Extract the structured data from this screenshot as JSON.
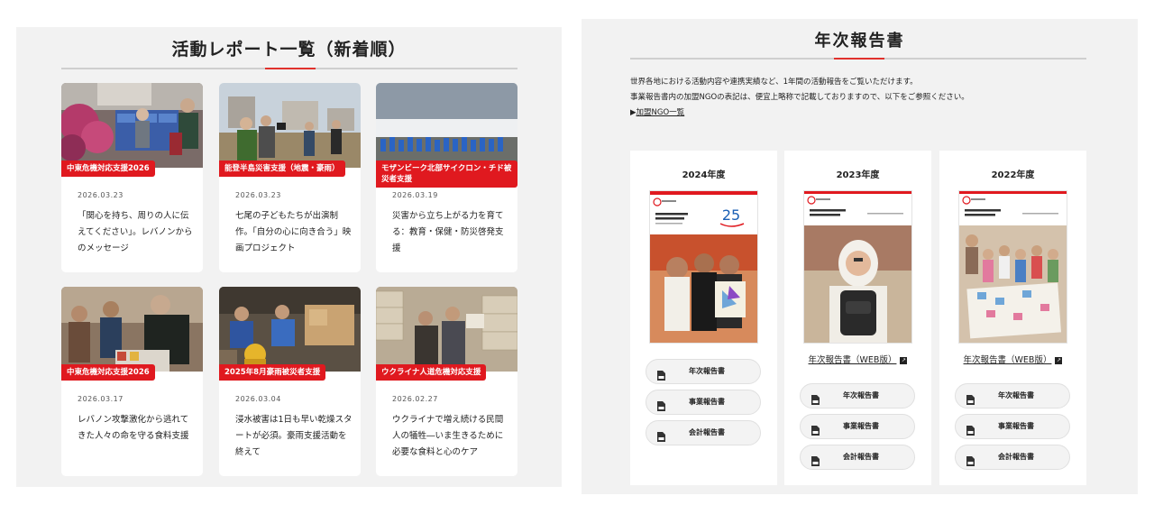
{
  "activity": {
    "title": "活動レポート一覧（新着順）",
    "cards": [
      {
        "tag": "中東危機対応支援2026",
        "date": "2026.03.23",
        "text": "「関心を持ち、周りの人に伝えてください」。レバノンからのメッセージ"
      },
      {
        "tag": "能登半島災害支援（地震・豪雨）",
        "date": "2026.03.23",
        "text": "七尾の子どもたちが出演制作。「自分の心に向き合う」映画プロジェクト"
      },
      {
        "tag": "モザンビーク北部サイクロン・チド被災者支援",
        "date": "2026.03.19",
        "text": "災害から立ち上がる力を育てる：教育・保健・防災啓発支援"
      },
      {
        "tag": "中東危機対応支援2026",
        "date": "2026.03.17",
        "text": "レバノン攻撃激化から逃れてきた人々の命を守る食料支援"
      },
      {
        "tag": "2025年8月豪雨被災者支援",
        "date": "2026.03.04",
        "text": "浸水被害は1日も早い乾燥スタートが必須。豪雨支援活動を終えて"
      },
      {
        "tag": "ウクライナ人道危機対応支援",
        "date": "2026.02.27",
        "text": "ウクライナで増え続ける民間人の犠牲―いま生きるために必要な食料と心のケア"
      }
    ]
  },
  "annual": {
    "title": "年次報告書",
    "intro_line1": "世界各地における活動内容や連携実績など、1年間の活動報告をご覧いただけます。",
    "intro_line2": "事業報告書内の加盟NGOの表記は、便宜上略称で記載しておりますので、以下をご参照ください。",
    "ngo_link_prefix": "▶",
    "ngo_link": "加盟NGO一覧",
    "years": [
      {
        "label": "2024年度",
        "cover_title": "ジャパン・プラットフォーム",
        "cover_subtitle": "2024年度年次報告書",
        "cover_en": "JAPAN PLATFORM ANNUAL REPORT 2024",
        "anniversary": "25",
        "web_link": "",
        "buttons": [
          "年次報告書",
          "事業報告書",
          "会計報告書"
        ]
      },
      {
        "label": "2023年度",
        "cover_title": "ジャパン・プラットフォーム",
        "cover_subtitle": "2023年度年次報告書",
        "cover_en": "JAPAN PLATFORM ANNUAL REPORT 2023",
        "anniversary": "",
        "web_link": "年次報告書（WEB版）",
        "buttons": [
          "年次報告書",
          "事業報告書",
          "会計報告書"
        ]
      },
      {
        "label": "2022年度",
        "cover_title": "ジャパン・プラットフォーム",
        "cover_subtitle": "2022年度年次報告書",
        "cover_en": "JAPAN PLATFORM ANNUAL REPORT 2022",
        "anniversary": "",
        "web_link": "年次報告書（WEB版）",
        "buttons": [
          "年次報告書",
          "事業報告書",
          "会計報告書"
        ]
      }
    ]
  },
  "colors": {
    "accent": "#e0191f",
    "panel": "#f2f2f2"
  }
}
